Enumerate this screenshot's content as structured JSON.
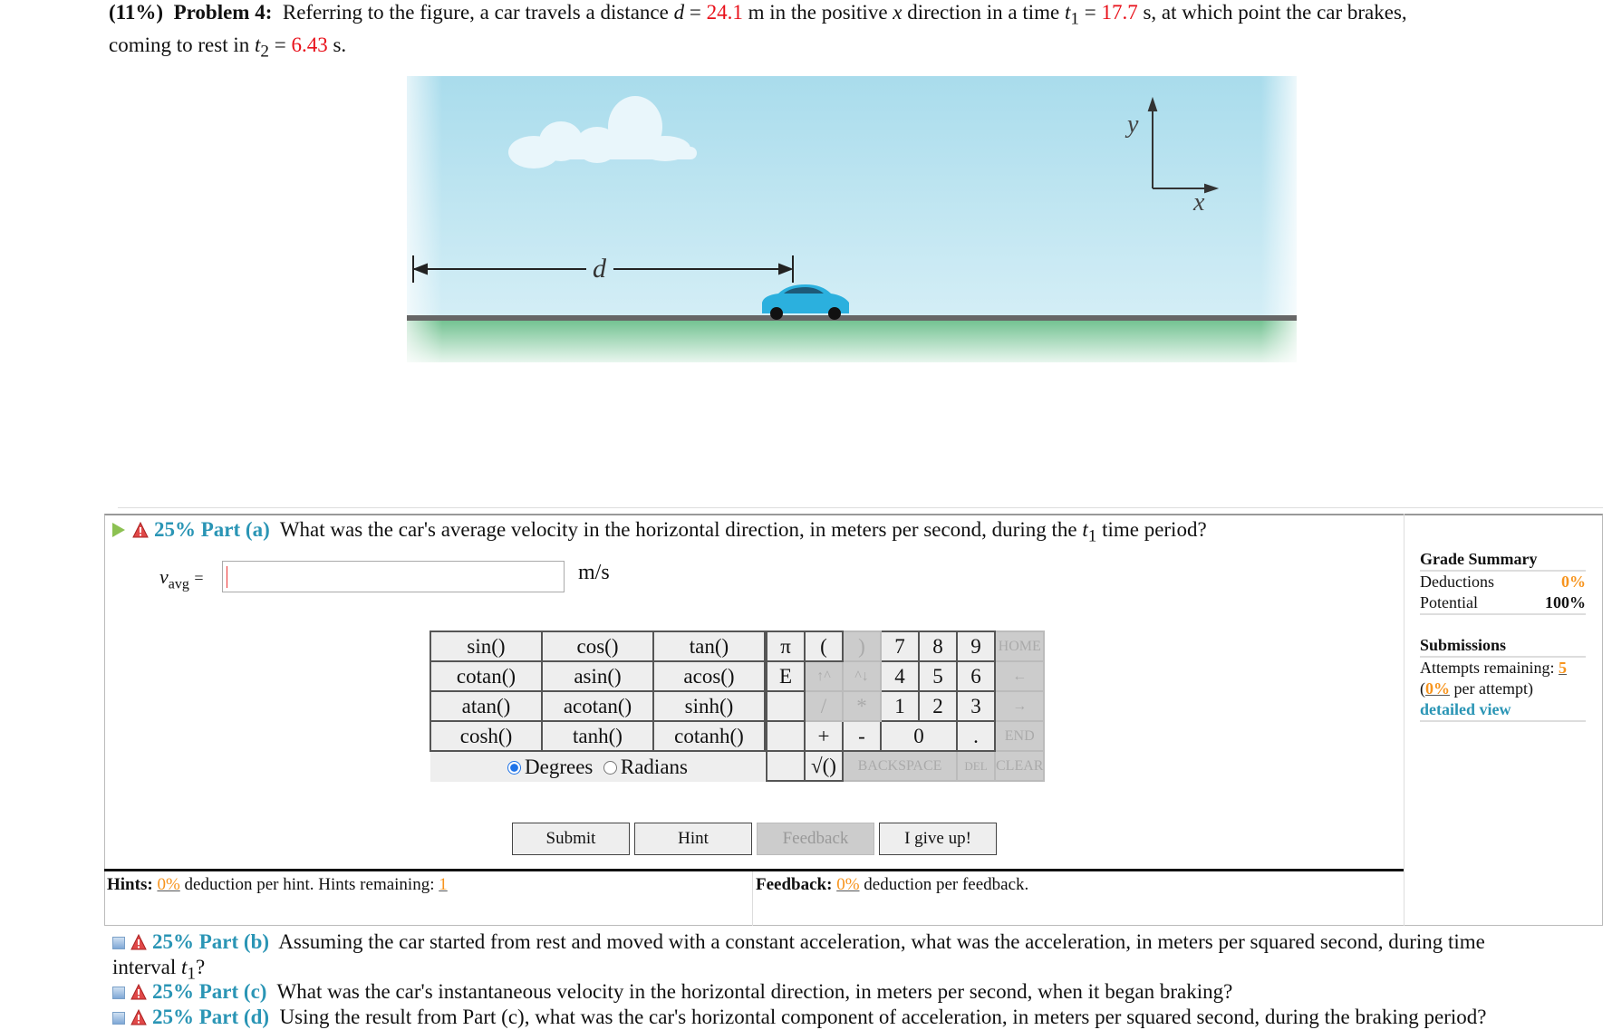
{
  "problem": {
    "weight": "(11%)",
    "title": "Problem 4:",
    "text_before_d": "Referring to the figure, a car travels a distance",
    "d_symbol": "d",
    "eq": "=",
    "d_value": "24.1",
    "d_unit": "m in the positive",
    "x_symbol": "x",
    "text_direction": "direction in a time",
    "t1_symbol": "t",
    "t1_sub": "1",
    "t1_value": "17.7",
    "t1_after": "s, at which point the car brakes,",
    "line2_before": "coming to rest in",
    "t2_symbol": "t",
    "t2_sub": "2",
    "t2_value": "6.43",
    "t2_after": "s."
  },
  "figure": {
    "distance_label": "d",
    "axis_y_label": "y",
    "axis_x_label": "x"
  },
  "part_a": {
    "weight": "25% Part (a)",
    "question_before": "What was the car's average velocity in the horizontal direction, in meters per second, during the",
    "t_symbol": "t",
    "t_sub": "1",
    "question_after": "time period?",
    "answer_var": "v",
    "answer_sub": "avg",
    "answer_eq": "=",
    "answer_value": "",
    "unit": "m/s"
  },
  "calculator": {
    "functions": [
      [
        "sin()",
        "cos()",
        "tan()"
      ],
      [
        "cotan()",
        "asin()",
        "acos()"
      ],
      [
        "atan()",
        "acotan()",
        "sinh()"
      ],
      [
        "cosh()",
        "tanh()",
        "cotanh()"
      ]
    ],
    "angle_mode": {
      "options": [
        "Degrees",
        "Radians"
      ],
      "selected": "Degrees"
    },
    "keys": {
      "pi": "π",
      "open_paren": "(",
      "close_paren": ")",
      "k7": "7",
      "k8": "8",
      "k9": "9",
      "home": "HOME",
      "e": "E",
      "up_caret": "↑^",
      "caret_down": "^↓",
      "k4": "4",
      "k5": "5",
      "k6": "6",
      "left": "←",
      "divide": "/",
      "multiply": "*",
      "k1": "1",
      "k2": "2",
      "k3": "3",
      "right": "→",
      "plus": "+",
      "minus": "-",
      "k0": "0",
      "dot": ".",
      "end": "END",
      "sqrt": "√()",
      "backspace": "BACKSPACE",
      "del": "DEL",
      "clear": "CLEAR"
    }
  },
  "actions": {
    "submit": "Submit",
    "hint": "Hint",
    "feedback": "Feedback",
    "give_up": "I give up!"
  },
  "hints": {
    "label": "Hints:",
    "deduction": "0%",
    "text": "deduction per hint. Hints remaining:",
    "remaining": "1"
  },
  "feedback": {
    "label": "Feedback:",
    "deduction": "0%",
    "text": "deduction per feedback."
  },
  "grade_summary": {
    "title": "Grade Summary",
    "deductions_label": "Deductions",
    "deductions_value": "0%",
    "potential_label": "Potential",
    "potential_value": "100%",
    "submissions_title": "Submissions",
    "attempts_label": "Attempts remaining:",
    "attempts_value": "5",
    "per_attempt_open": "(",
    "per_attempt_value": "0%",
    "per_attempt_text": "per attempt)",
    "detailed_view": "detailed view"
  },
  "other_parts": [
    {
      "weight": "25% Part (b)",
      "question": "Assuming the car started from rest and moved with a constant acceleration, what was the acceleration, in meters per squared second, during time",
      "line2_before": "interval",
      "t_symbol": "t",
      "t_sub": "1",
      "line2_after": "?"
    },
    {
      "weight": "25% Part (c)",
      "question": "What was the car's instantaneous velocity in the horizontal direction, in meters per second, when it began braking?"
    },
    {
      "weight": "25% Part (d)",
      "question": "Using the result from Part (c), what was the car's horizontal component of acceleration, in meters per squared second, during the braking period?"
    }
  ],
  "colors": {
    "given_value": "#e8101a",
    "part_label": "#2a95b5",
    "percent": "#f7941d",
    "sky": "#b3e1ee",
    "ground": "#7cc79b",
    "car": "#2bb0de"
  }
}
